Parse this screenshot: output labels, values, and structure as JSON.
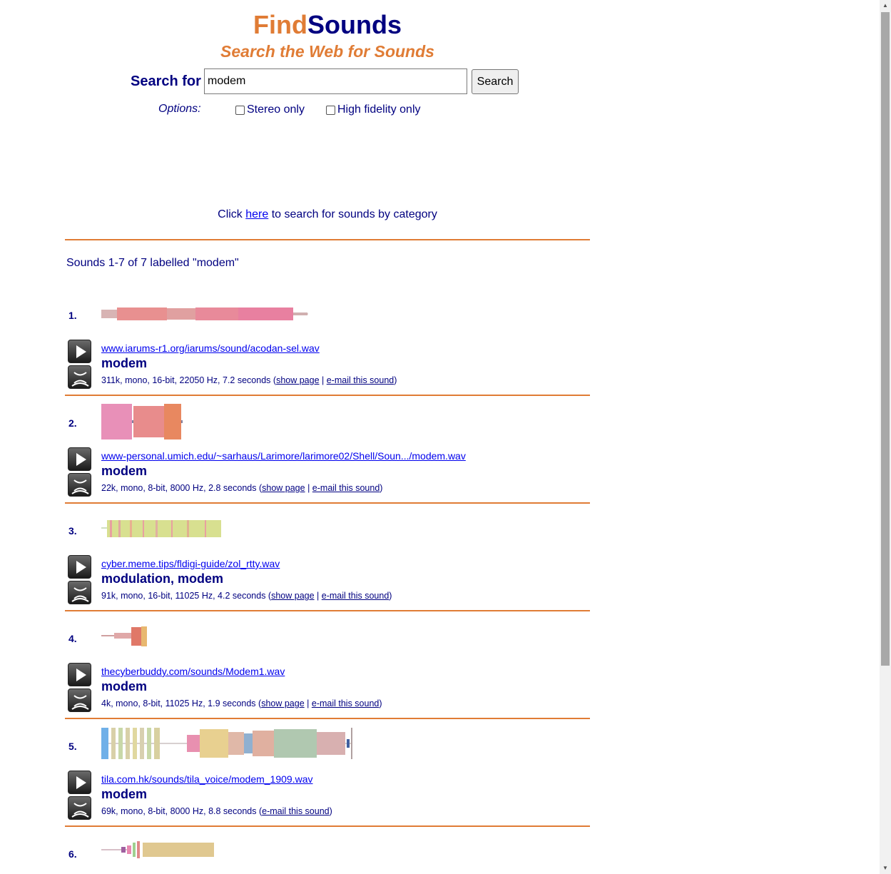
{
  "header": {
    "logo_find": "Find",
    "logo_sounds": "Sounds",
    "tagline": "Search the Web for Sounds"
  },
  "search": {
    "label": "Search for",
    "value": "modem",
    "button_label": "Search",
    "options_label": "Options:",
    "stereo_label": "Stereo only",
    "stereo_checked": false,
    "hifi_label": "High fidelity only",
    "hifi_checked": false
  },
  "category": {
    "prefix": "Click ",
    "link": "here",
    "suffix": " to search for sounds by category"
  },
  "results_summary": "Sounds 1-7 of 7 labelled \"modem\"",
  "colors": {
    "accent_orange": "#e07c35",
    "navy": "#000080",
    "link_blue": "#0000ee"
  },
  "results": [
    {
      "number": "1.",
      "url": "www.iarums-r1.org/iarums/sound/acodan-sel.wav",
      "label": "modem",
      "meta": "311k, mono, 16-bit, 22050 Hz, 7.2 seconds (",
      "show_page": "show page",
      "sep": " | ",
      "email": "e-mail this sound",
      "close": ")"
    },
    {
      "number": "2.",
      "url": "www-personal.umich.edu/~sarhaus/Larimore/larimore02/Shell/Soun.../modem.wav",
      "label": "modem",
      "meta": "22k, mono, 8-bit, 8000 Hz, 2.8 seconds (",
      "show_page": "show page",
      "sep": " | ",
      "email": "e-mail this sound",
      "close": ")"
    },
    {
      "number": "3.",
      "url": "cyber.meme.tips/fldigi-guide/zol_rtty.wav",
      "label": "modulation, modem",
      "meta": "91k, mono, 16-bit, 11025 Hz, 4.2 seconds (",
      "show_page": "show page",
      "sep": " | ",
      "email": "e-mail this sound",
      "close": ")"
    },
    {
      "number": "4.",
      "url": "thecyberbuddy.com/sounds/Modem1.wav",
      "label": "modem",
      "meta": "4k, mono, 8-bit, 11025 Hz, 1.9 seconds (",
      "show_page": "show page",
      "sep": " | ",
      "email": "e-mail this sound",
      "close": ")"
    },
    {
      "number": "5.",
      "url": "tila.com.hk/sounds/tila_voice/modem_1909.wav",
      "label": "modem",
      "meta": "69k, mono, 8-bit, 8000 Hz, 8.8 seconds (",
      "email": "e-mail this sound",
      "close": ")"
    },
    {
      "number": "6."
    }
  ]
}
